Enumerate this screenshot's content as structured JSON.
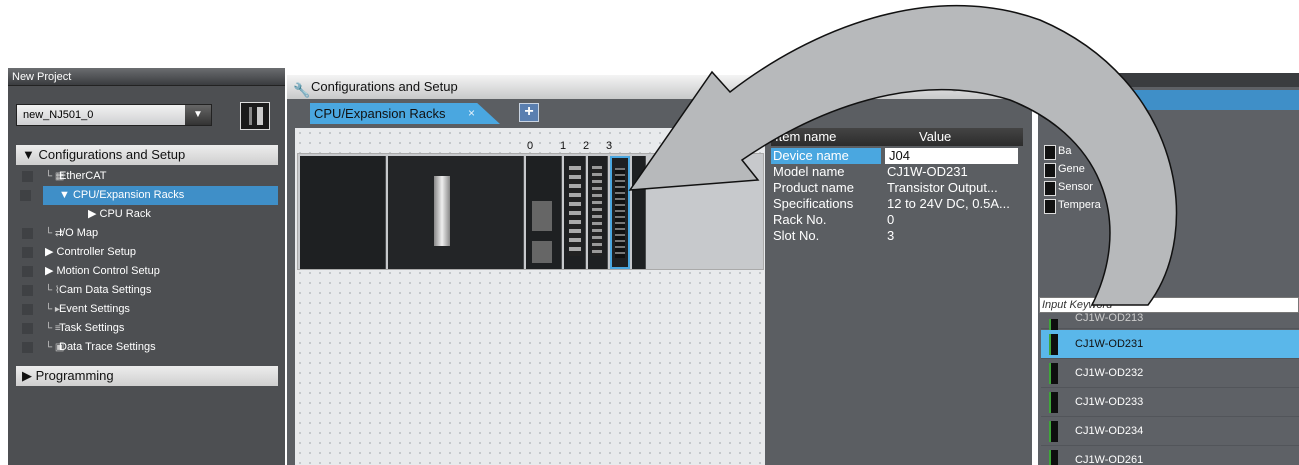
{
  "left_panel": {
    "header": "New Project",
    "device_select": "new_NJ501_0",
    "sections": {
      "config": "▼ Configurations and Setup",
      "programming": "▶ Programming"
    },
    "tree": [
      {
        "label": "EtherCAT",
        "icon": "ethercat-icon"
      },
      {
        "label": "▼ CPU/Expansion Racks",
        "icon": "rack-icon",
        "selected": true
      },
      {
        "label": "▶ CPU Rack",
        "icon": "cpu-rack-icon"
      },
      {
        "label": "I/O Map",
        "icon": "io-map-icon"
      },
      {
        "label": "▶ Controller Setup",
        "icon": "controller-setup-icon"
      },
      {
        "label": "▶ Motion Control Setup",
        "icon": "motion-icon"
      },
      {
        "label": "Cam Data Settings",
        "icon": "cam-icon"
      },
      {
        "label": "Event Settings",
        "icon": "event-icon"
      },
      {
        "label": "Task Settings",
        "icon": "task-icon"
      },
      {
        "label": "Data Trace Settings",
        "icon": "trace-icon"
      }
    ]
  },
  "config_panel": {
    "title": "Configurations and Setup",
    "tab": "CPU/Expansion Racks",
    "tab_close": "×",
    "add_tab": "+",
    "slot_numbers": [
      "0",
      "1",
      "2",
      "3"
    ],
    "properties": {
      "header_item": "Item name",
      "header_value": "Value",
      "rows": [
        {
          "k": "Device name",
          "v": "J04"
        },
        {
          "k": "Model name",
          "v": "CJ1W-OD231"
        },
        {
          "k": "Product name",
          "v": "Transistor Output..."
        },
        {
          "k": "Specifications",
          "v": "12 to 24V DC, 0.5A..."
        },
        {
          "k": "Rack No.",
          "v": "0"
        },
        {
          "k": "Slot No.",
          "v": "3"
        }
      ]
    }
  },
  "right_panel": {
    "categories": [
      "Ba",
      "Gene",
      "Sensor",
      "Tempera"
    ],
    "keyword_placeholder": "Input Keyword",
    "products": [
      "CJ1W-OD213",
      "CJ1W-OD231",
      "CJ1W-OD232",
      "CJ1W-OD233",
      "CJ1W-OD234",
      "CJ1W-OD261"
    ],
    "selected_product": "CJ1W-OD231"
  },
  "colors": {
    "accent": "#4aa7e0",
    "selection": "#3f8fc8",
    "panel": "#5b5e62",
    "arrow": "#b5b7b9"
  }
}
